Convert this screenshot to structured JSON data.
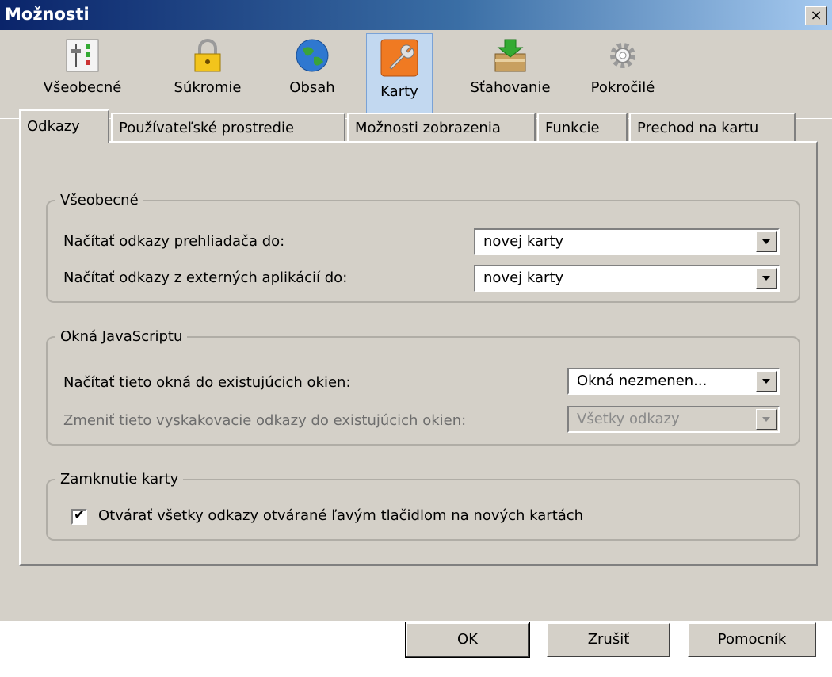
{
  "window": {
    "title": "Možnosti",
    "close_glyph": "×"
  },
  "toolbar": {
    "items": [
      {
        "label": "Všeobecné",
        "icon": "general-settings-icon"
      },
      {
        "label": "Súkromie",
        "icon": "lock-icon"
      },
      {
        "label": "Obsah",
        "icon": "globe-icon"
      },
      {
        "label": "Karty",
        "icon": "wrench-icon",
        "selected": true
      },
      {
        "label": "Sťahovanie",
        "icon": "download-box-icon"
      },
      {
        "label": "Pokročilé",
        "icon": "gear-icon"
      }
    ]
  },
  "tabs": [
    {
      "label": "Odkazy",
      "active": true
    },
    {
      "label": "Používateľské prostredie"
    },
    {
      "label": "Možnosti zobrazenia"
    },
    {
      "label": "Funkcie"
    },
    {
      "label": "Prechod na kartu"
    }
  ],
  "groups": {
    "general": {
      "legend": "Všeobecné",
      "browser_links_label": "Načítať odkazy prehliadača do:",
      "browser_links_value": "novej karty",
      "external_links_label": "Načítať odkazy z externých aplikácií do:",
      "external_links_value": "novej karty"
    },
    "javascript": {
      "legend": "Okná JavaScriptu",
      "load_windows_label": "Načítať tieto okná do existujúcich okien:",
      "load_windows_value": "Okná nezmenen...",
      "popup_links_label": "Zmeniť tieto vyskakovacie odkazy do existujúcich okien:",
      "popup_links_value": "Všetky odkazy"
    },
    "tab_lock": {
      "legend": "Zamknutie karty",
      "checkbox_label": "Otvárať všetky odkazy otvárané ľavým tlačidlom na nových kartách",
      "checked": true
    }
  },
  "buttons": {
    "ok": "OK",
    "cancel": "Zrušiť",
    "help": "Pomocník"
  },
  "colors": {
    "dialog_bg": "#d4d0c8",
    "title_start": "#0a246a",
    "selected_toolbar": "#c2d8f0"
  }
}
